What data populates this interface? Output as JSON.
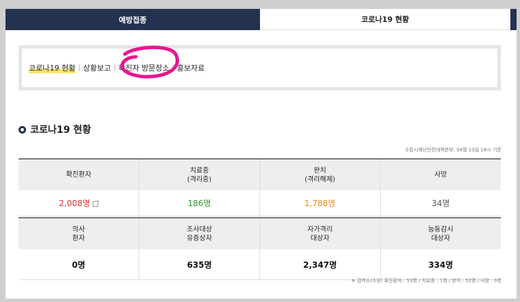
{
  "tabs": [
    {
      "label": "예방접종"
    },
    {
      "label": "코로나19 현황"
    }
  ],
  "submenu": [
    {
      "label": "코로나19 현황"
    },
    {
      "label": "상황보고"
    },
    {
      "label": "확진자 방문장소"
    },
    {
      "label": "홍보자료"
    }
  ],
  "section": {
    "title": "코로나19 현황",
    "source": "수원시재난안전대책본부, 04월 13일 18시 기준"
  },
  "stats1": {
    "headers": [
      {
        "line1": "확진환자",
        "line2": ""
      },
      {
        "line1": "치료중",
        "line2": "(격리중)"
      },
      {
        "line1": "완치",
        "line2": "(격리해제)"
      },
      {
        "line1": "사망",
        "line2": ""
      }
    ],
    "values": [
      "2,008명",
      "186명",
      "1,788명",
      "34명"
    ]
  },
  "stats2": {
    "headers": [
      {
        "line1": "의사",
        "line2": "환자"
      },
      {
        "line1": "조사대상",
        "line2": "유증상자"
      },
      {
        "line1": "자가격리",
        "line2": "대상자"
      },
      {
        "line1": "능동감시",
        "line2": "대상자"
      }
    ],
    "values": [
      "0명",
      "635명",
      "2,347명",
      "334명"
    ]
  },
  "footnote": "※ 검역소(수원) 확진환자 : 53명 / 치료중 : 1명 / 완치 : 52명 / 사망 : 0명",
  "colors": {
    "navy": "#23324f",
    "red": "#d9342b",
    "green": "#2e9a2e",
    "orange": "#f08a1a",
    "highlight": "#ffe36b",
    "annotation": "#e8168f"
  }
}
